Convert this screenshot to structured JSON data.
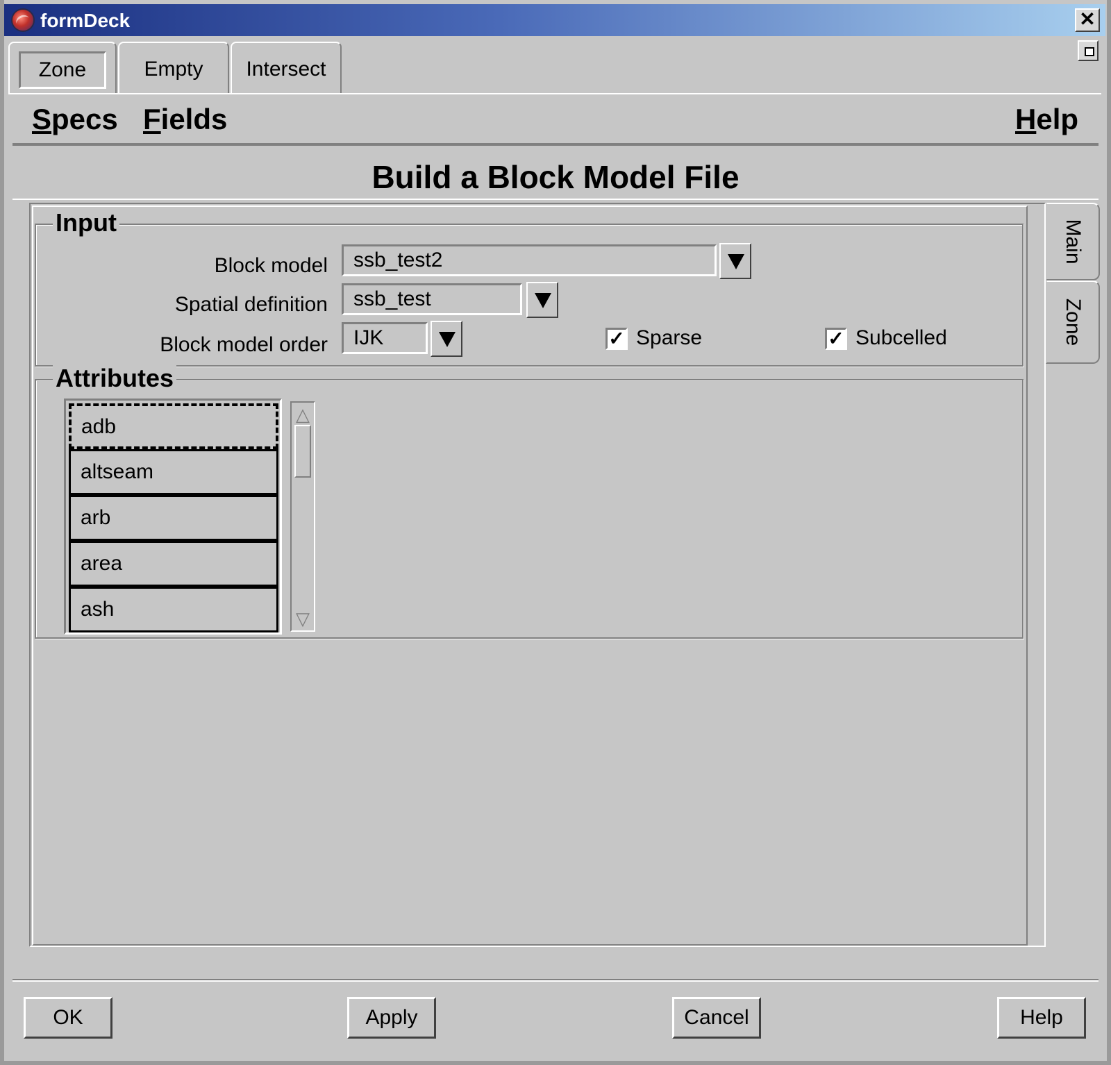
{
  "window": {
    "title": "formDeck",
    "close_glyph": "✕"
  },
  "top_tabs": [
    {
      "label": "Zone",
      "active": true
    },
    {
      "label": "Empty",
      "active": false
    },
    {
      "label": "Intersect",
      "active": false
    }
  ],
  "menubar": {
    "specs": {
      "first": "S",
      "rest": "pecs"
    },
    "fields": {
      "first": "F",
      "rest": "ields"
    },
    "help": {
      "first": "H",
      "rest": "elp"
    }
  },
  "page_title": "Build a Block Model File",
  "side_tabs": [
    {
      "label": "Main",
      "active": true
    },
    {
      "label": "Zone",
      "active": false
    }
  ],
  "input": {
    "title": "Input",
    "block_model": {
      "label": "Block model",
      "value": "ssb_test2"
    },
    "spatial_definition": {
      "label": "Spatial definition",
      "value": "ssb_test"
    },
    "block_model_order": {
      "label": "Block model order",
      "value": "IJK"
    },
    "sparse": {
      "label": "Sparse",
      "checked": true
    },
    "subcelled": {
      "label": "Subcelled",
      "checked": true
    },
    "check_glyph": "✓"
  },
  "attributes": {
    "title": "Attributes",
    "items": [
      "adb",
      "altseam",
      "arb",
      "area",
      "ash"
    ],
    "scroll_up_glyph": "△",
    "scroll_down_glyph": "▽"
  },
  "buttons": {
    "ok": "OK",
    "apply": "Apply",
    "cancel": "Cancel",
    "help": "Help"
  }
}
